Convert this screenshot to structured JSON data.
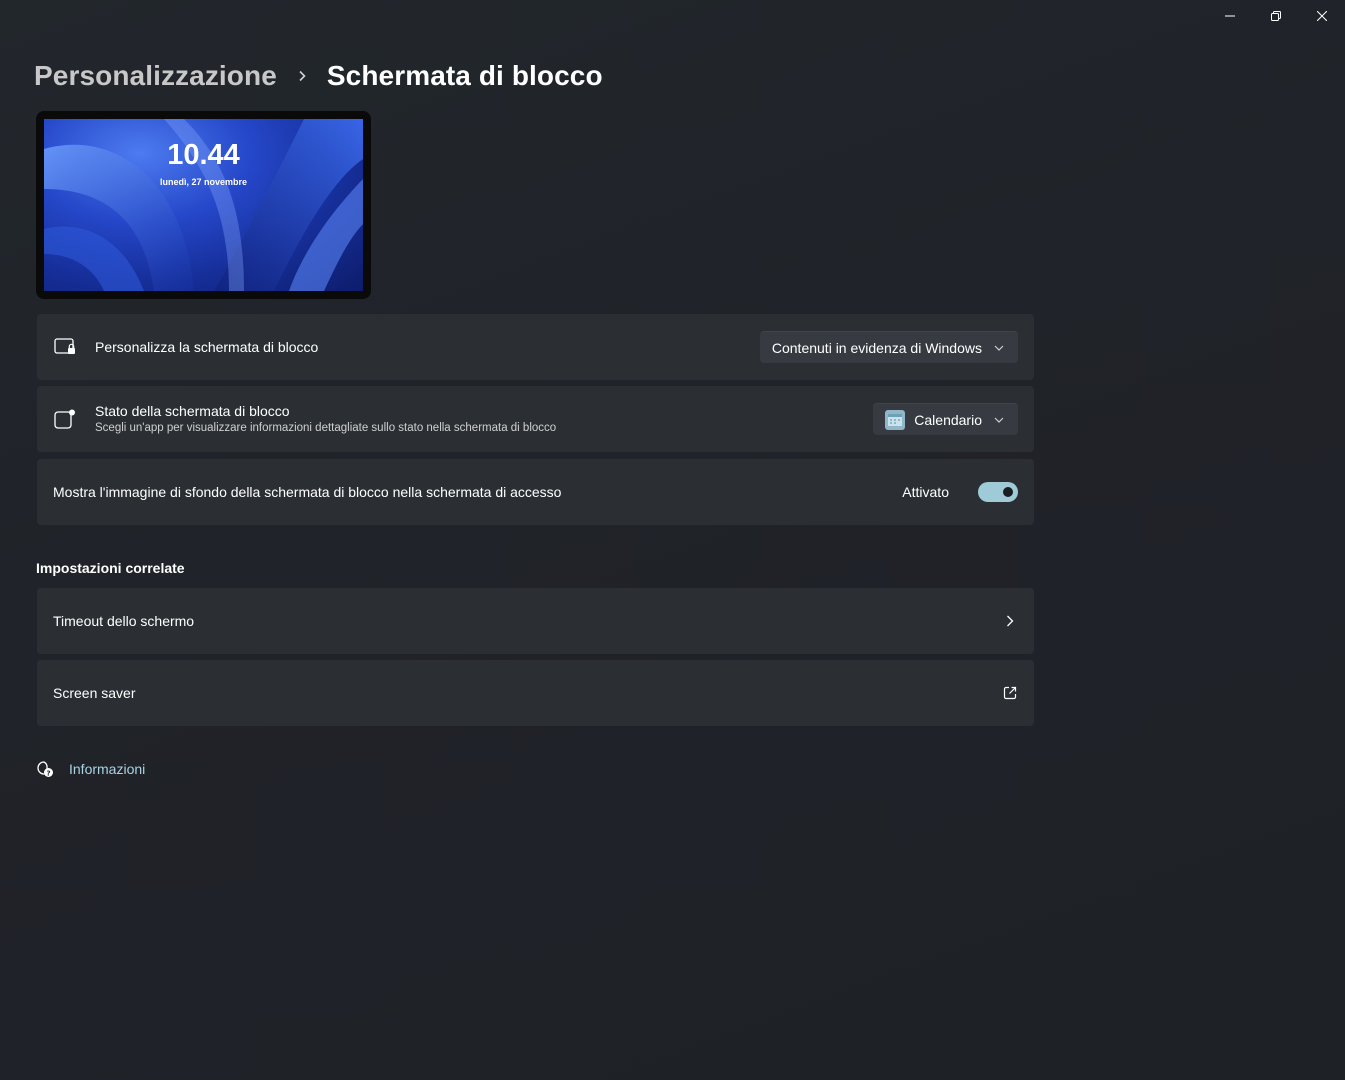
{
  "window": {
    "caption": {
      "minimize_icon": "minimize-icon",
      "maximize_icon": "restore-icon",
      "close_icon": "close-icon"
    }
  },
  "breadcrumb": {
    "parent": "Personalizzazione",
    "separator_icon": "chevron-right-icon",
    "current": "Schermata di blocco"
  },
  "preview": {
    "time": "10.44",
    "date": "lunedì, 27 novembre"
  },
  "settings": [
    {
      "icon": "lock-screen-icon",
      "title": "Personalizza la schermata di blocco",
      "control": "dropdown",
      "value": "Contenuti in evidenza di Windows"
    },
    {
      "icon": "app-status-icon",
      "title": "Stato della schermata di blocco",
      "subtitle": "Scegli un'app per visualizzare informazioni dettagliate sullo stato nella schermata di blocco",
      "control": "dropdown",
      "value": "Calendario",
      "value_icon": "calendar-icon"
    },
    {
      "title": "Mostra l'immagine di sfondo della schermata di blocco nella schermata di accesso",
      "control": "toggle",
      "state_label": "Attivato",
      "on": true
    }
  ],
  "related": {
    "title": "Impostazioni correlate",
    "items": [
      {
        "title": "Timeout dello schermo",
        "trail_icon": "chevron-right-icon"
      },
      {
        "title": "Screen saver",
        "trail_icon": "external-link-icon"
      }
    ]
  },
  "help": {
    "icon": "help-chat-icon",
    "label": "Informazioni"
  },
  "colors": {
    "background": "#202329",
    "card": "#2b2f34",
    "accent": "#9fcbd9",
    "link": "#a8d3e4"
  }
}
